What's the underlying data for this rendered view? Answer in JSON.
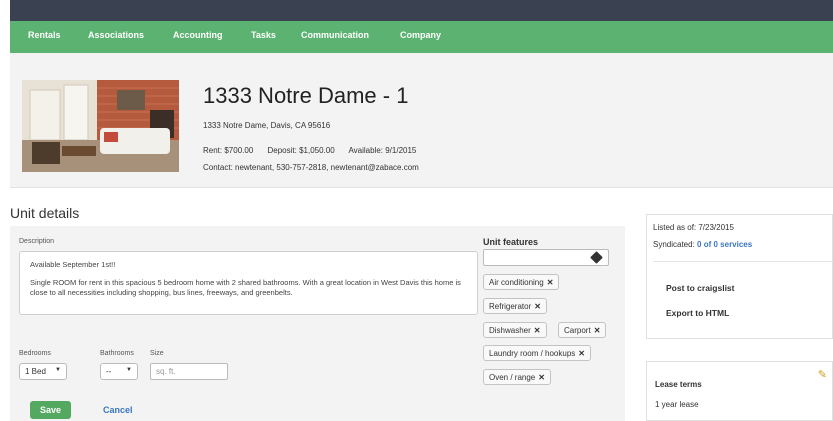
{
  "nav": {
    "items": [
      "Rentals",
      "Associations",
      "Accounting",
      "Tasks",
      "Communication",
      "Company"
    ],
    "active": "Rentals",
    "accent_color": "#5cb270"
  },
  "property": {
    "title": "1333 Notre Dame - 1",
    "address": "1333 Notre Dame, Davis, CA 95616",
    "rent": "Rent: $700.00",
    "deposit": "Deposit: $1,050.00",
    "available": "Available: 9/1/2015",
    "contact": "Contact: newtenant, 530-757-2818, newtenant@zabace.com"
  },
  "unit_details": {
    "heading": "Unit details",
    "description_label": "Description",
    "description_line1": "Available September 1st!!",
    "description_line2": "Single ROOM for rent in this spacious 5 bedroom home with 2 shared bathrooms. With a great location in West Davis this home is close to all necessities including shopping, bus lines, freeways, and greenbelts.",
    "bedrooms_label": "Bedrooms",
    "bedrooms_value": "1 Bed",
    "bathrooms_label": "Bathrooms",
    "bathrooms_value": "--",
    "size_label": "Size",
    "size_placeholder": "sq. ft.",
    "save_label": "Save",
    "cancel_label": "Cancel"
  },
  "unit_features": {
    "title": "Unit features",
    "tags": [
      "Air conditioning",
      "Refrigerator",
      "Dishwasher",
      "Carport",
      "Laundry room / hookups",
      "Oven / range"
    ]
  },
  "listing": {
    "listed_as_of": "Listed as of: 7/23/2015",
    "syndicated_label": "Syndicated:",
    "syndicated_link": "0 of 0 services",
    "post_craigslist": "Post to craigslist",
    "export_html": "Export to HTML"
  },
  "lease_terms": {
    "title": "Lease terms",
    "value": "1 year lease"
  }
}
